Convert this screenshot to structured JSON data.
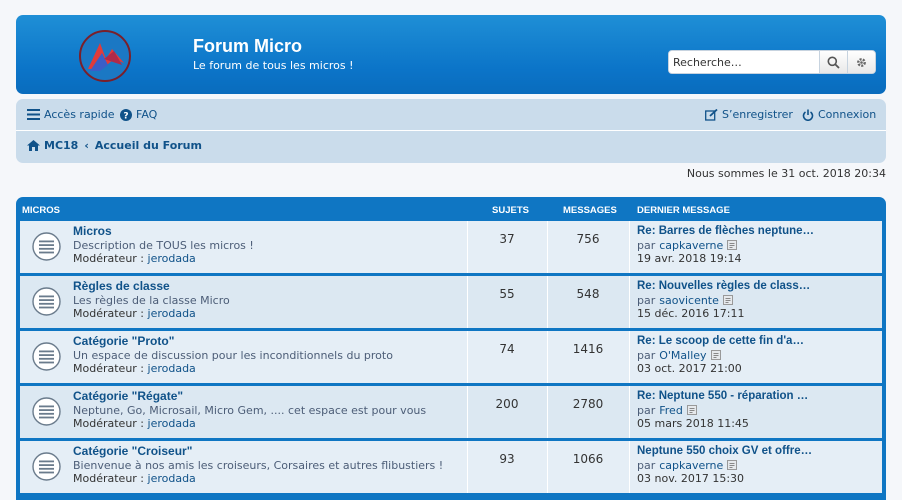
{
  "header": {
    "title": "Forum Micro",
    "description": "Le forum de tous les micros !",
    "search_placeholder": "Recherche…"
  },
  "nav": {
    "quick_access": "Accès rapide",
    "faq": "FAQ",
    "register": "S’enregistrer",
    "login": "Connexion",
    "breadcrumb_home": "MC18",
    "breadcrumb_forum": "Accueil du Forum"
  },
  "datetime": "Nous sommes le 31 oct. 2018 20:34",
  "table": {
    "col_forum": "MICROS",
    "col_topics": "SUJETS",
    "col_posts": "MESSAGES",
    "col_last": "DERNIER MESSAGE",
    "moderator_label": "Modérateur : ",
    "by_label": "par",
    "rows": [
      {
        "title": "Micros",
        "desc": "Description de TOUS les micros !",
        "moderator": "jerodada",
        "topics": "37",
        "posts": "756",
        "last_title": "Re: Barres de flèches neptune…",
        "last_by": "capkaverne",
        "last_date": "19 avr. 2018 19:14"
      },
      {
        "title": "Règles de classe",
        "desc": "Les règles de la classe Micro",
        "moderator": "jerodada",
        "topics": "55",
        "posts": "548",
        "last_title": "Re: Nouvelles règles de class…",
        "last_by": "saovicente",
        "last_date": "15 déc. 2016 17:11"
      },
      {
        "title": "Catégorie \"Proto\"",
        "desc": "Un espace de discussion pour les inconditionnels du proto",
        "moderator": "jerodada",
        "topics": "74",
        "posts": "1416",
        "last_title": "Re: Le scoop de cette fin d'a…",
        "last_by": "O'Malley",
        "last_date": "03 oct. 2017 21:00"
      },
      {
        "title": "Catégorie \"Régate\"",
        "desc": "Neptune, Go, Microsail, Micro Gem, .... cet espace est pour vous",
        "moderator": "jerodada",
        "topics": "200",
        "posts": "2780",
        "last_title": "Re: Neptune 550 - réparation …",
        "last_by": "Fred",
        "last_date": "05 mars 2018 11:45"
      },
      {
        "title": "Catégorie \"Croiseur\"",
        "desc": "Bienvenue à nos amis les croiseurs, Corsaires et autres flibustiers !",
        "moderator": "jerodada",
        "topics": "93",
        "posts": "1066",
        "last_title": "Neptune 550 choix GV et offre…",
        "last_by": "capkaverne",
        "last_date": "03 nov. 2017 15:30"
      }
    ]
  },
  "colors": {
    "header_blue": "#0b74c8",
    "link": "#105289",
    "nav_bg": "#cadceb"
  }
}
